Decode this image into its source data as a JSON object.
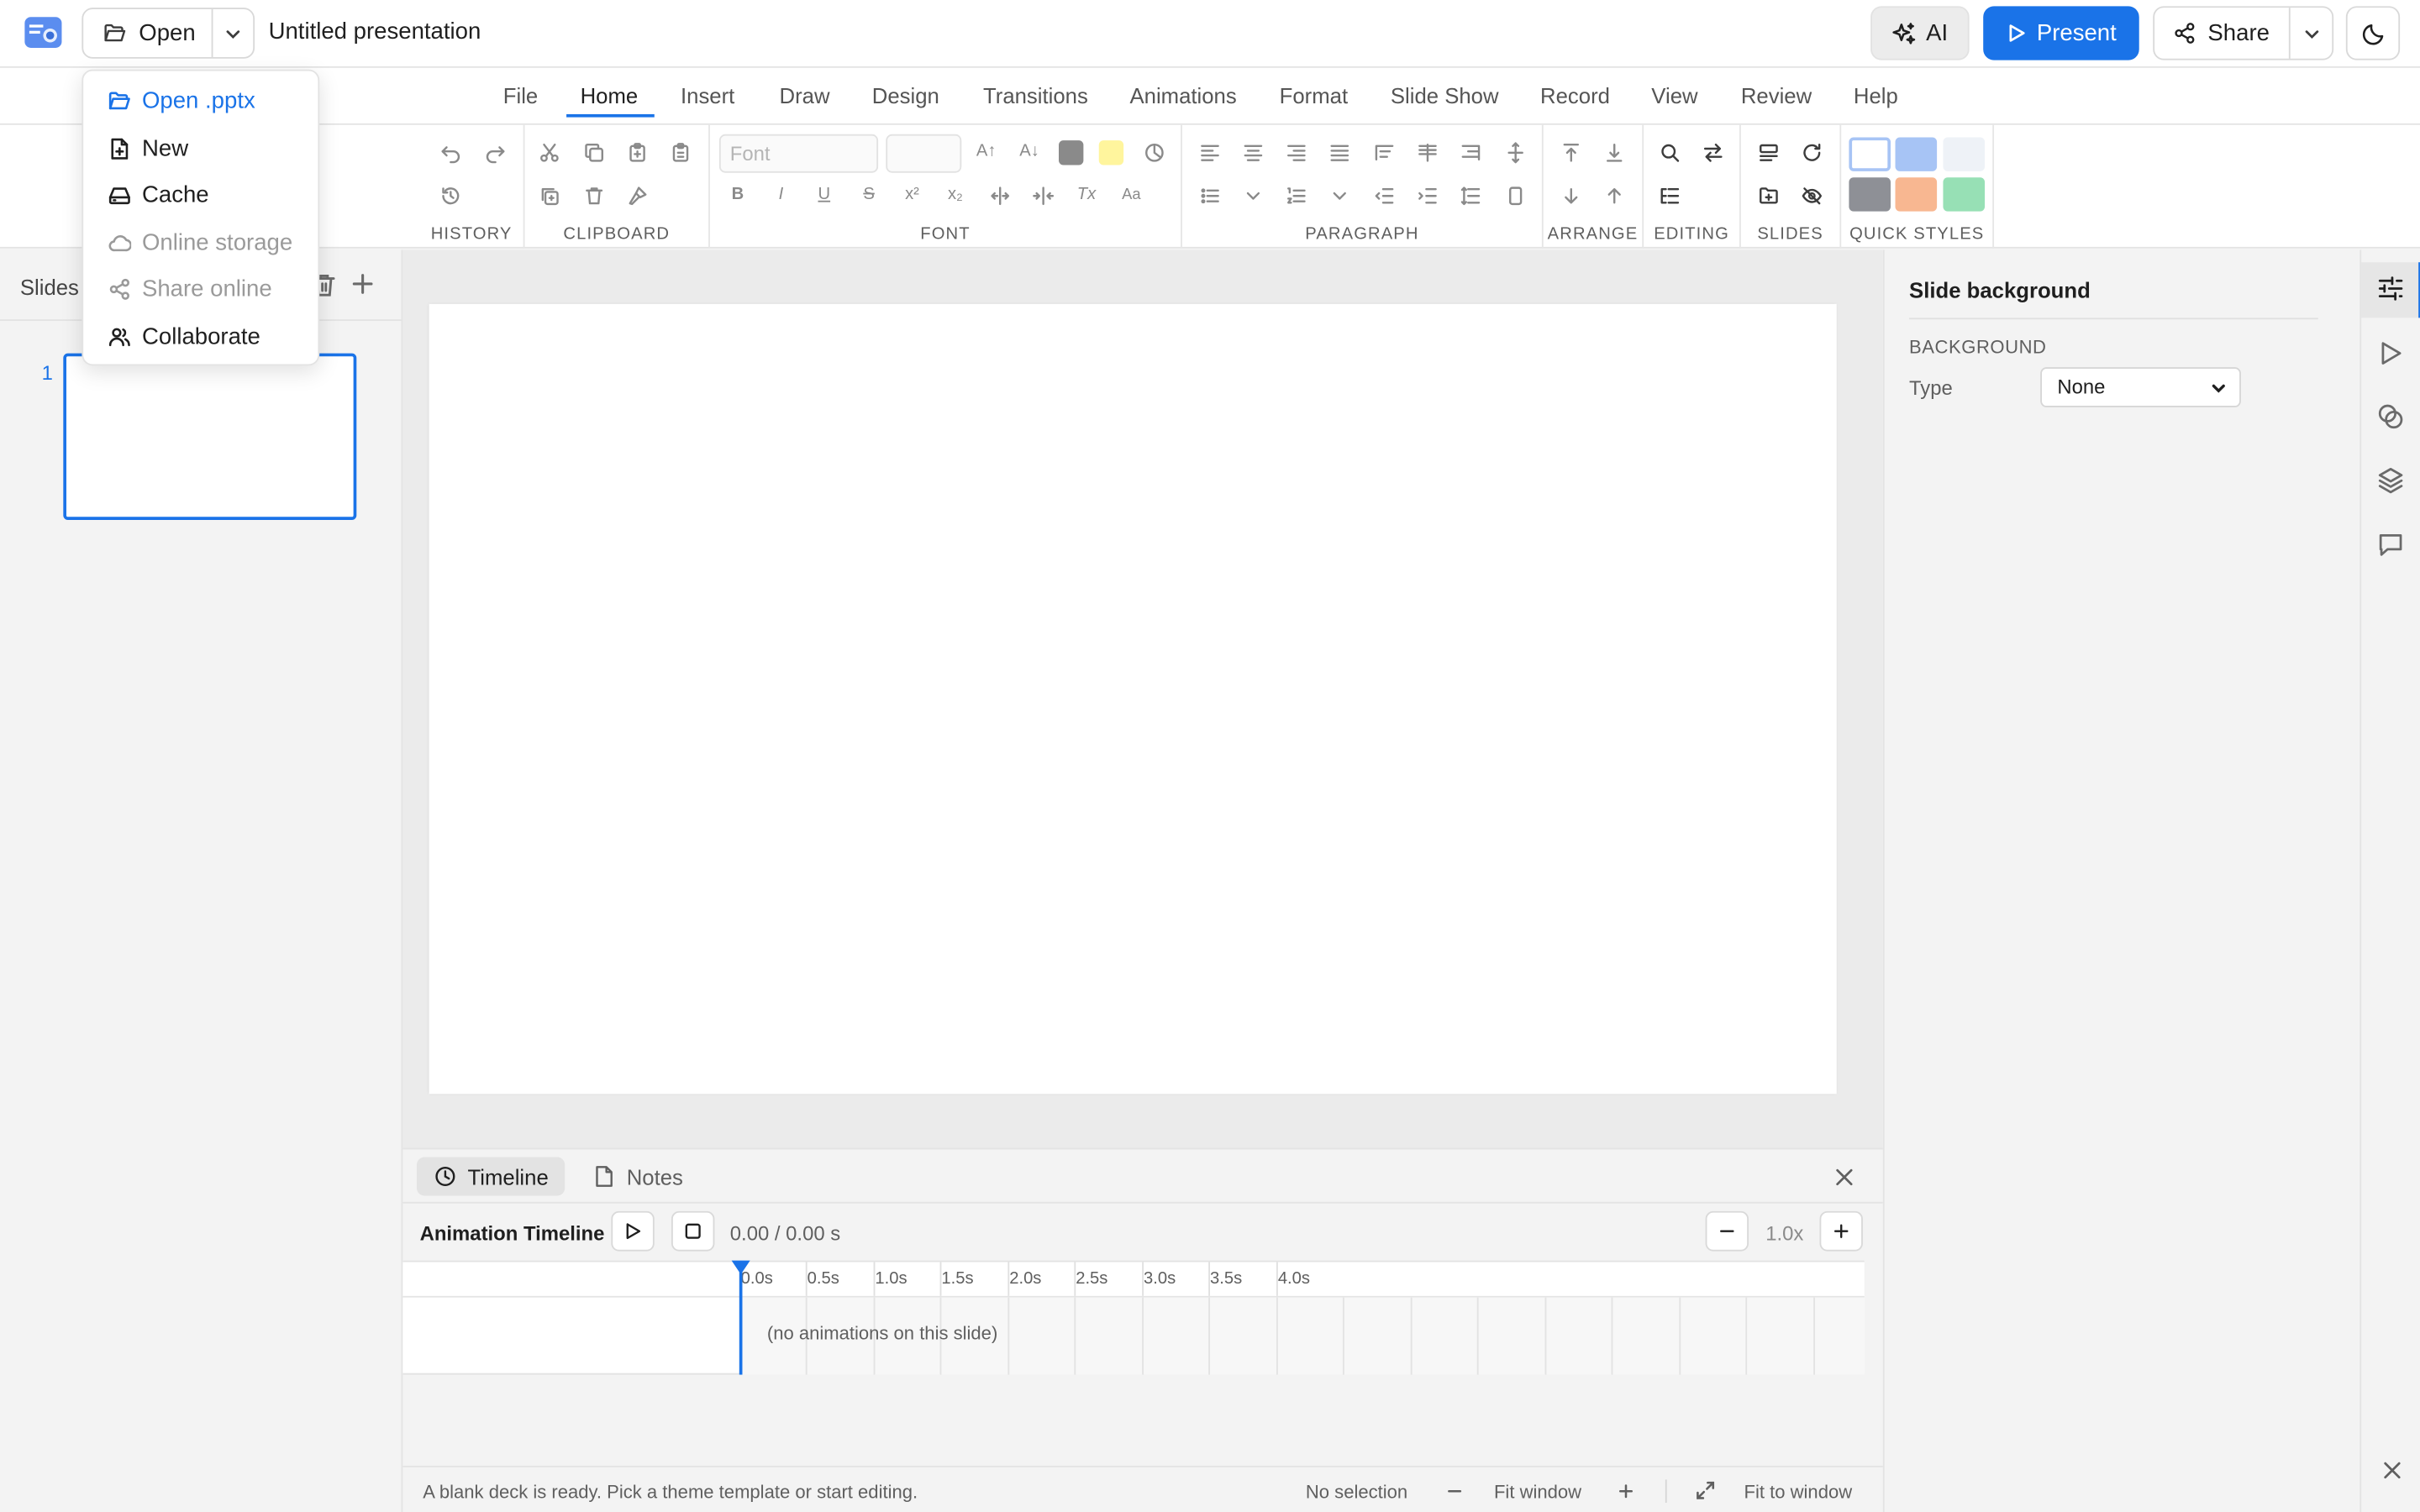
{
  "header": {
    "open_label": "Open",
    "doc_title": "Untitled presentation",
    "ai_label": "AI",
    "present_label": "Present",
    "share_label": "Share"
  },
  "open_menu": {
    "items": [
      {
        "label": "Open .pptx",
        "icon": "folder-open-icon",
        "state": "highlighted"
      },
      {
        "label": "New",
        "icon": "file-plus-icon",
        "state": "enabled"
      },
      {
        "label": "Cache",
        "icon": "drive-icon",
        "state": "enabled"
      },
      {
        "label": "Online storage",
        "icon": "cloud-icon",
        "state": "disabled"
      },
      {
        "label": "Share online",
        "icon": "share-icon",
        "state": "disabled"
      },
      {
        "label": "Collaborate",
        "icon": "users-icon",
        "state": "enabled"
      }
    ]
  },
  "menu": {
    "tabs": [
      "File",
      "Home",
      "Insert",
      "Draw",
      "Design",
      "Transitions",
      "Animations",
      "Format",
      "Slide Show",
      "Record",
      "View",
      "Review",
      "Help"
    ],
    "active": "Home"
  },
  "ribbon": {
    "groups": [
      "HISTORY",
      "CLIPBOARD",
      "FONT",
      "PARAGRAPH",
      "ARRANGE",
      "EDITING",
      "SLIDES",
      "QUICK STYLES"
    ],
    "font_placeholder": "Font",
    "font_color": "#8a8a8a",
    "highlight_color": "#fff59d",
    "quick_styles": [
      "#ffffff",
      "#a7c4f5",
      "#eef2f7",
      "#8e9096",
      "#f8b791",
      "#97e0b5"
    ]
  },
  "slides_panel": {
    "title": "Slides",
    "slide_number": "1"
  },
  "timeline": {
    "tab_timeline": "Timeline",
    "tab_notes": "Notes",
    "title": "Animation Timeline",
    "time": "0.00 / 0.00 s",
    "zoom": "1.0x",
    "ticks": [
      "0.0s",
      "0.5s",
      "1.0s",
      "1.5s",
      "2.0s",
      "2.5s",
      "3.0s",
      "3.5s",
      "4.0s"
    ],
    "empty": "(no animations on this slide)"
  },
  "status": {
    "message": "A blank deck is ready. Pick a theme template or start editing.",
    "selection": "No selection",
    "fit_window": "Fit window",
    "fit_to_window": "Fit to window"
  },
  "properties": {
    "title": "Slide background",
    "section": "BACKGROUND",
    "type_label": "Type",
    "type_value": "None"
  },
  "colors": {
    "accent": "#1a73e8"
  }
}
